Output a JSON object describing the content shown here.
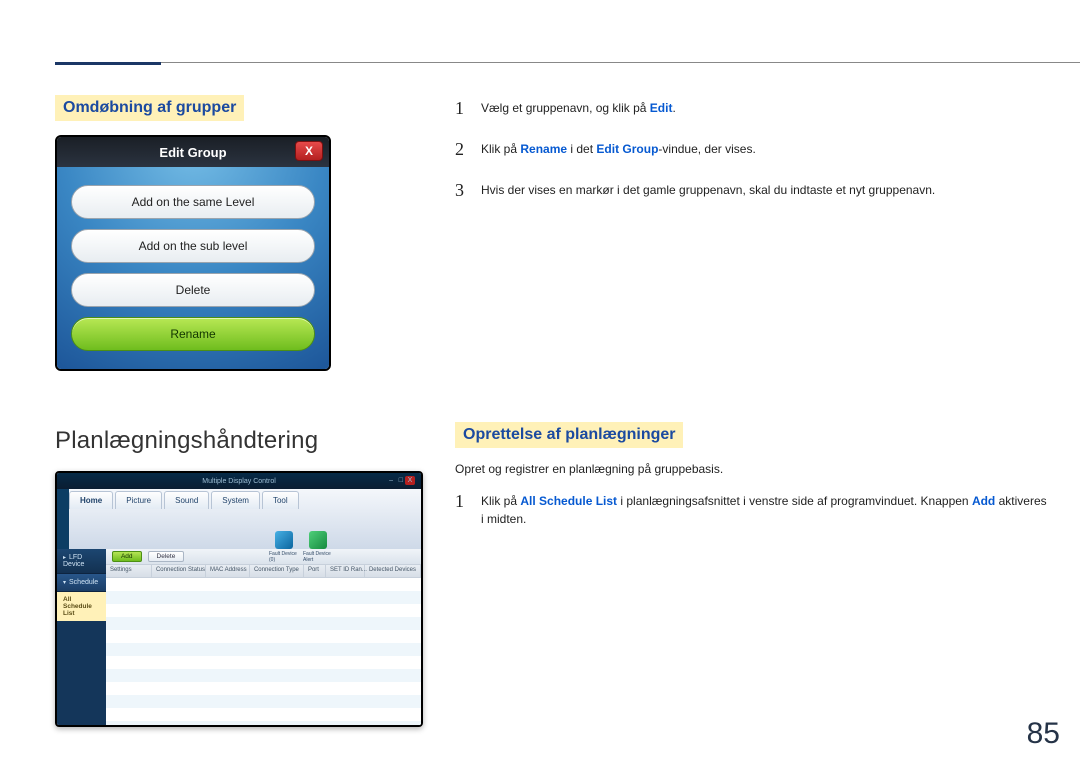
{
  "page_number": "85",
  "left": {
    "subheading": "Omdøbning af grupper",
    "heading": "Planlægningshåndtering"
  },
  "right": {
    "subheading": "Oprettelse af planlægninger",
    "intro": "Opret og registrer en planlægning på gruppebasis."
  },
  "editgroup": {
    "title": "Edit Group",
    "close": "X",
    "btn_same": "Add on the same Level",
    "btn_sub": "Add on the sub level",
    "btn_delete": "Delete",
    "btn_rename": "Rename"
  },
  "steps_top": {
    "n1": "1",
    "t1_a": "Vælg et gruppenavn, og klik på ",
    "t1_kw": "Edit",
    "t1_b": ".",
    "n2": "2",
    "t2_a": "Klik på ",
    "t2_kw1": "Rename",
    "t2_b": " i det ",
    "t2_kw2": "Edit Group",
    "t2_c": "-vindue, der vises.",
    "n3": "3",
    "t3": "Hvis der vises en markør i det gamle gruppenavn, skal du indtaste et nyt gruppenavn."
  },
  "steps_bottom": {
    "n1": "1",
    "t1_a": "Klik på ",
    "t1_kw1": "All Schedule List",
    "t1_b": " i planlægningsafsnittet i venstre side af programvinduet. Knappen ",
    "t1_kw2": "Add",
    "t1_c": " aktiveres i midten."
  },
  "app": {
    "title": "Multiple Display Control",
    "tabs": {
      "home": "Home",
      "picture": "Picture",
      "sound": "Sound",
      "system": "System",
      "tool": "Tool"
    },
    "ribbon": {
      "fault_device": "Fault Device (0)",
      "fault_alert": "Fault Device Alert"
    },
    "sidebar": {
      "lfd": "LFD Device",
      "schedule": "Schedule",
      "all_list": "All Schedule List"
    },
    "toolbar": {
      "add": "Add",
      "delete": "Delete"
    },
    "columns": {
      "c1": "Settings",
      "c2": "Connection Status",
      "c3": "MAC Address",
      "c4": "Connection Type",
      "c5": "Port",
      "c6": "SET ID Ran...",
      "c7": "Detected Devices"
    }
  }
}
